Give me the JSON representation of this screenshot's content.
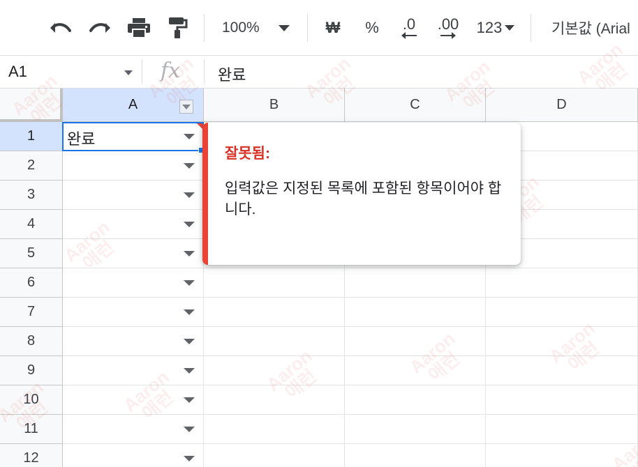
{
  "toolbar": {
    "undo_icon": "undo-icon",
    "redo_icon": "redo-icon",
    "print_icon": "print-icon",
    "paint_format_icon": "paint-format-icon",
    "zoom": "100%",
    "currency": "₩",
    "percent": "%",
    "decrease_decimal": ".0",
    "increase_decimal": ".00",
    "more_formats": "123",
    "font": "기본값 (Arial"
  },
  "formula_bar": {
    "cell_ref": "A1",
    "fx_label": "fx",
    "formula": "완료"
  },
  "sheet": {
    "columns": [
      "A",
      "B",
      "C",
      "D"
    ],
    "rows": [
      "1",
      "2",
      "3",
      "4",
      "5",
      "6",
      "7",
      "8",
      "9",
      "10",
      "11",
      "12"
    ],
    "cells": {
      "A1": "완료"
    }
  },
  "validation_popup": {
    "title": "잘못됨:",
    "message": "입력값은 지정된 목록에 포함된 항목이어야 합니다."
  },
  "watermark": {
    "line1": "Aaron",
    "line2": "애런"
  },
  "colors": {
    "accent": "#1a73e8",
    "error": "#ea4335",
    "selected_header": "#d3e3fd"
  }
}
